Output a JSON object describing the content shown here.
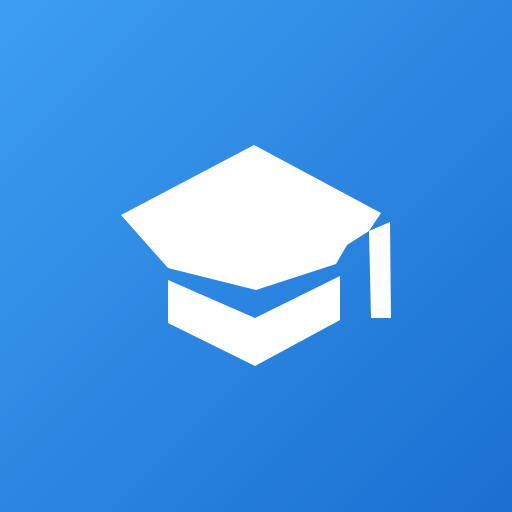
{
  "icon": {
    "name": "graduation-cap-icon",
    "background": {
      "gradient_start": "#3D9EF1",
      "gradient_end": "#1B6FD1"
    },
    "foreground_color": "#FFFFFF"
  }
}
